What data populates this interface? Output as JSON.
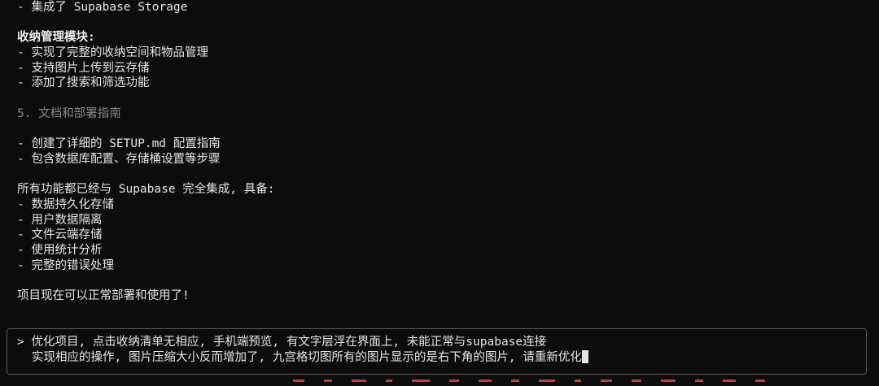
{
  "output_lines": [
    "- 集成了 Supabase Storage",
    "",
    "收纳管理模块:",
    "- 实现了完整的收纳空间和物品管理",
    "- 支持图片上传到云存储",
    "- 添加了搜索和筛选功能",
    "",
    "5. 文档和部署指南",
    "",
    "- 创建了详细的 SETUP.md 配置指南",
    "- 包含数据库配置、存储桶设置等步骤",
    "",
    "所有功能都已经与 Supabase 完全集成, 具备:",
    "- 数据持久化存储",
    "- 用户数据隔离",
    "- 文件云端存储",
    "- 使用统计分析",
    "- 完整的错误处理",
    "",
    "项目现在可以正常部署和使用了!"
  ],
  "input": {
    "prompt_symbol": ">",
    "line1": "优化项目, 点击收纳清单无相应, 手机端预览, 有文字层浮在界面上, 未能正常与supabase连接",
    "line2": "实现相应的操作, 图片压缩大小反而增加了, 九宫格切图所有的图片显示的是右下角的图片, 请重新优化"
  }
}
